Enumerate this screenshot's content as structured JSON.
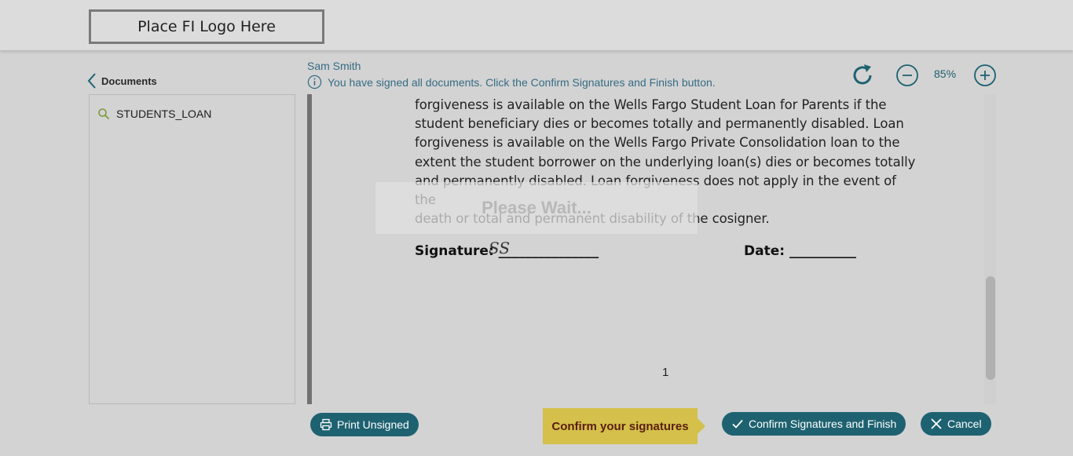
{
  "header": {
    "logo_text": "Place FI Logo Here"
  },
  "sidebar": {
    "back_label": "Documents",
    "items": [
      {
        "label": "STUDENTS_LOAN",
        "icon": "search-icon"
      }
    ]
  },
  "status": {
    "user_name": "Sam Smith",
    "message": "You have signed all documents. Click the Confirm Signatures and Finish button.",
    "message_icon": "info-icon"
  },
  "toolbar": {
    "zoom_level": "85%",
    "refresh_icon": "refresh-icon",
    "zoom_out_icon": "zoom-out-icon",
    "zoom_in_icon": "zoom-in-icon"
  },
  "document": {
    "lines": [
      "forgiveness is available on the Wells Fargo Student Loan for Parents if the",
      "student beneficiary dies or becomes totally and permanently disabled. Loan",
      "forgiveness is available on the Wells Fargo Private Consolidation loan to the",
      "extent the student borrower on the underlying loan(s) dies or becomes totally",
      "and permanently disabled. Loan forgiveness does not apply in the event of the",
      "death or total and permanent disability of the cosigner."
    ],
    "signature_label": "Signature: _______________",
    "signature_mark": "SS",
    "date_label": "Date: __________",
    "page_number": "1"
  },
  "overlay": {
    "wait_text": "Please Wait..."
  },
  "footer": {
    "print_label": "Print Unsigned",
    "callout_text": "Confirm your signatures",
    "confirm_label": "Confirm Signatures and Finish",
    "cancel_label": "Cancel"
  },
  "colors": {
    "accent": "#1e6271",
    "callout": "#d4c04a",
    "info_text": "#356c84"
  }
}
